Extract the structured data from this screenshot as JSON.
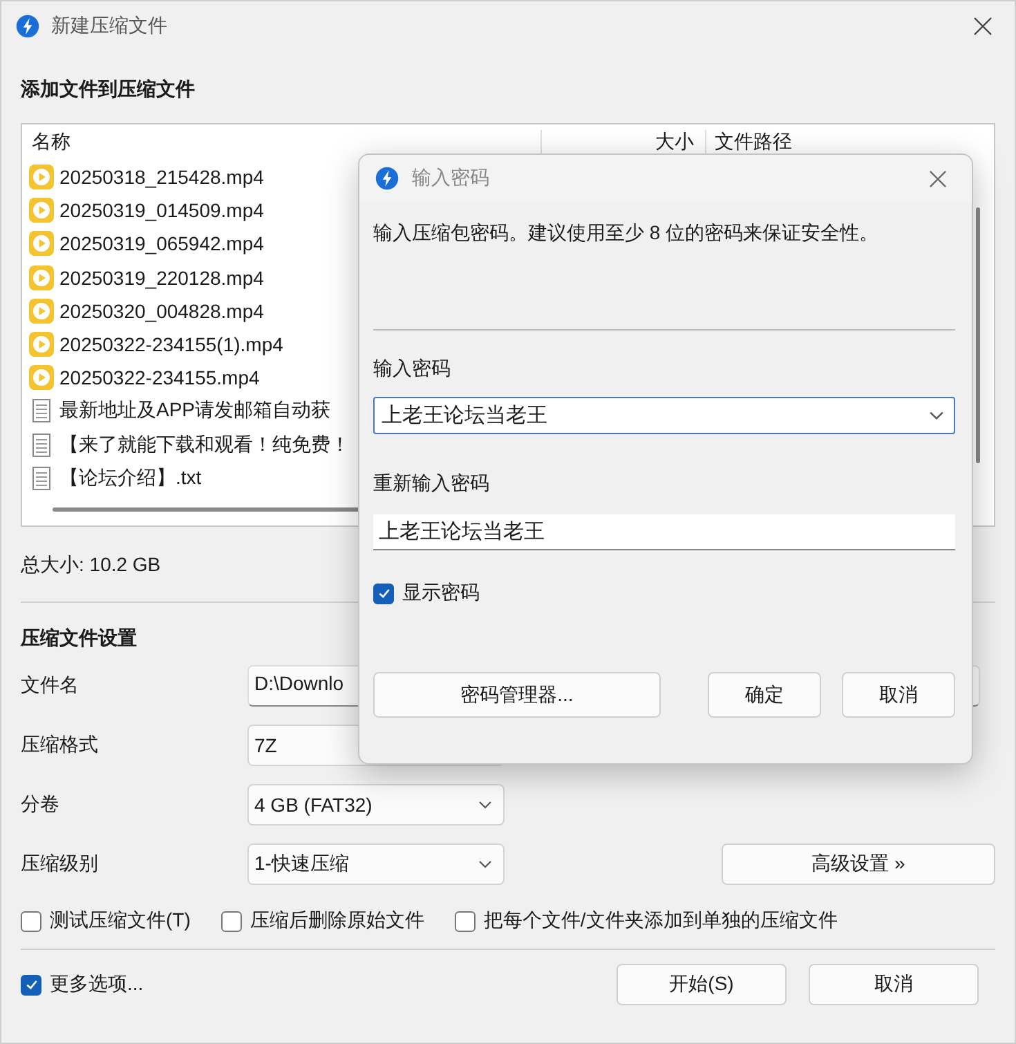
{
  "window": {
    "title": "新建压缩文件"
  },
  "files": {
    "heading": "添加文件到压缩文件",
    "columns": [
      "名称",
      "大小",
      "文件路径"
    ],
    "rows": [
      {
        "name": "20250318_215428.mp4",
        "kind": "video"
      },
      {
        "name": "20250319_014509.mp4",
        "kind": "video"
      },
      {
        "name": "20250319_065942.mp4",
        "kind": "video"
      },
      {
        "name": "20250319_220128.mp4",
        "kind": "video"
      },
      {
        "name": "20250320_004828.mp4",
        "kind": "video"
      },
      {
        "name": "20250322-234155(1).mp4",
        "kind": "video"
      },
      {
        "name": "20250322-234155.mp4",
        "kind": "video"
      },
      {
        "name": "最新地址及APP请发邮箱自动获",
        "kind": "text"
      },
      {
        "name": "【来了就能下载和观看！纯免费！",
        "kind": "text"
      },
      {
        "name": "【论坛介绍】.txt",
        "kind": "text"
      }
    ]
  },
  "total_size": "总大小: 10.2 GB",
  "settings": {
    "heading": "压缩文件设置",
    "fields": [
      {
        "label": "文件名",
        "value": "D:\\Downlo",
        "kind": "text"
      },
      {
        "label": "压缩格式",
        "value": "7Z",
        "kind": "box"
      },
      {
        "label": "分卷",
        "value": "4 GB (FAT32)",
        "kind": "dropdown"
      },
      {
        "label": "压缩级别",
        "value": "1-快速压缩",
        "kind": "dropdown"
      }
    ],
    "advanced_button": "高级设置 »",
    "options": [
      {
        "label": "测试压缩文件(T)",
        "checked": false
      },
      {
        "label": "压缩后删除原始文件",
        "checked": false
      },
      {
        "label": "把每个文件/文件夹添加到单独的压缩文件",
        "checked": false
      }
    ]
  },
  "more_options": {
    "label": "更多选项...",
    "checked": true
  },
  "buttons": [
    "开始(S)",
    "取消"
  ],
  "dialog": {
    "title": "输入密码",
    "description": "输入压缩包密码。建议使用至少 8 位的密码来保证安全性。",
    "password_label": "输入密码",
    "password": "上老王论坛当老王",
    "confirm_label": "重新输入密码",
    "confirm": "上老王论坛当老王",
    "show_password": {
      "label": "显示密码",
      "checked": true
    },
    "manager_button": "密码管理器...",
    "buttons": [
      "确定",
      "取消"
    ]
  }
}
